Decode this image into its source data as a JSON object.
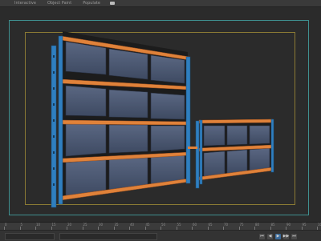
{
  "menu": {
    "items": [
      "Interactive",
      "Object Paint",
      "Populate"
    ]
  },
  "timeline": {
    "tick_labels": [
      "0",
      "5",
      "10",
      "15",
      "20",
      "25",
      "30",
      "35",
      "40",
      "45",
      "50",
      "55",
      "60",
      "65",
      "70",
      "75",
      "80",
      "85",
      "90",
      "95",
      "100"
    ]
  },
  "playback": {
    "buttons": [
      "⏮",
      "◀",
      "▶",
      "▶▶",
      "⏭"
    ]
  },
  "colors": {
    "shelf_orange": "#e0823a",
    "upright_blue": "#2f7fc0",
    "bin": "#4a5670",
    "frame_cyan": "#3f8f8f",
    "frame_gold": "#8a7a34"
  }
}
